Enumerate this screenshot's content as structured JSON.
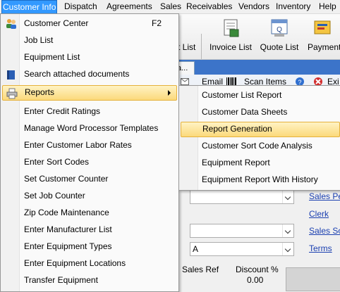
{
  "menubar": [
    "Customer Info",
    "Dispatch",
    "Agreements",
    "Sales",
    "Receivables",
    "Vendors",
    "Inventory",
    "Help"
  ],
  "toolbar": {
    "partial_label": "t List",
    "invoice_list": "Invoice List",
    "quote_list": "Quote List",
    "payments": "Payment"
  },
  "tab": {
    "label": "a..."
  },
  "subbar": {
    "email": "Email",
    "scan_items": "Scan Items",
    "exit_partial": "Exi"
  },
  "menu": {
    "items": [
      {
        "label": "Customer Center",
        "shortcut": "F2",
        "icon": "customers-icon"
      },
      {
        "label": "Job List"
      },
      {
        "label": "Equipment List"
      },
      {
        "label": "Search attached documents",
        "icon": "book-icon"
      },
      {
        "label": "Reports",
        "icon": "printer-icon",
        "submenu": true,
        "highlighted": true
      },
      {
        "label": "Enter Credit Ratings"
      },
      {
        "label": "Manage Word Processor Templates"
      },
      {
        "label": "Enter Customer Labor Rates"
      },
      {
        "label": "Enter Sort Codes"
      },
      {
        "label": "Set Customer Counter"
      },
      {
        "label": "Set Job Counter"
      },
      {
        "label": "Zip Code Maintenance"
      },
      {
        "label": "Enter Manufacturer List"
      },
      {
        "label": "Enter Equipment Types"
      },
      {
        "label": "Enter Equipment Locations"
      },
      {
        "label": "Transfer Equipment"
      }
    ]
  },
  "submenu": {
    "items": [
      {
        "label": "Customer List Report"
      },
      {
        "label": "Customer Data Sheets"
      },
      {
        "label": "Report Generation",
        "highlighted": true
      },
      {
        "label": "Customer Sort Code Analysis"
      },
      {
        "label": "Equipment Report"
      },
      {
        "label": "Equipment Report With History"
      }
    ]
  },
  "form": {
    "sales_person_link": "Sales Per",
    "clerk_link": "Clerk",
    "sales_source_link": "Sales Sor",
    "terms_link": "Terms",
    "terms_value": "A",
    "sales_ref_label": "Sales Ref",
    "discount_label": "Discount %",
    "discount_value": "0.00"
  },
  "colors": {
    "menubar_active": "#3399ff",
    "highlight_fill": "#fbd97b",
    "highlight_border": "#e5b13c",
    "tabstrip": "#3c74c9",
    "link": "#1a3fb0"
  }
}
